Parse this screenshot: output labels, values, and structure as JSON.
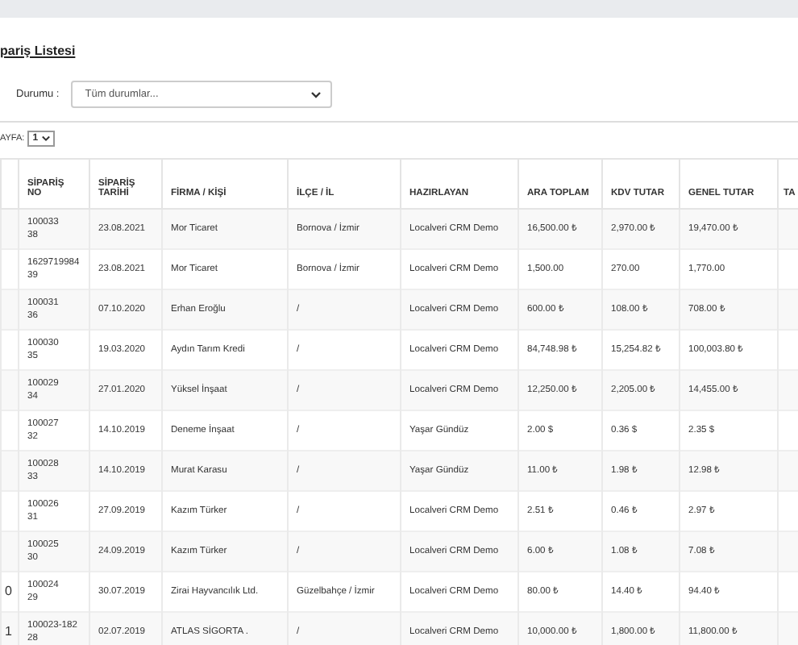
{
  "page": {
    "title": "pariş Listesi"
  },
  "filter": {
    "label": "Durumu :",
    "value": "Tüm durumlar..."
  },
  "pager": {
    "label": "AYFA:",
    "value": "1"
  },
  "table": {
    "columns": [
      "SİPARİŞ NO",
      "SİPARİŞ TARİHİ",
      "FİRMA / KİŞİ",
      "İLÇE / İL",
      "HAZIRLAYAN",
      "ARA TOPLAM",
      "KDV TUTAR",
      "GENEL TUTAR",
      "TA"
    ],
    "rows": [
      {
        "no": "100033 38",
        "date": "23.08.2021",
        "firm": "Mor Ticaret",
        "city": "Bornova / İzmir",
        "by": "Localveri CRM Demo",
        "sub": "16,500.00 ₺",
        "vat": "2,970.00 ₺",
        "total": "19,470.00 ₺"
      },
      {
        "no": "1629719984 39",
        "date": "23.08.2021",
        "firm": "Mor Ticaret",
        "city": "Bornova / İzmir",
        "by": "Localveri CRM Demo",
        "sub": "1,500.00",
        "vat": "270.00",
        "total": "1,770.00"
      },
      {
        "no": "100031 36",
        "date": "07.10.2020",
        "firm": "Erhan Eroğlu",
        "city": "/",
        "by": "Localveri CRM Demo",
        "sub": "600.00 ₺",
        "vat": "108.00 ₺",
        "total": "708.00 ₺"
      },
      {
        "no": "100030 35",
        "date": "19.03.2020",
        "firm": "Aydın Tarım Kredi",
        "city": "/",
        "by": "Localveri CRM Demo",
        "sub": "84,748.98 ₺",
        "vat": "15,254.82 ₺",
        "total": "100,003.80 ₺"
      },
      {
        "no": "100029 34",
        "date": "27.01.2020",
        "firm": "Yüksel İnşaat",
        "city": "/",
        "by": "Localveri CRM Demo",
        "sub": "12,250.00 ₺",
        "vat": "2,205.00 ₺",
        "total": "14,455.00 ₺"
      },
      {
        "no": "100027 32",
        "date": "14.10.2019",
        "firm": "Deneme İnşaat",
        "city": "/",
        "by": "Yaşar Gündüz",
        "sub": "2.00 $",
        "vat": "0.36 $",
        "total": "2.35 $"
      },
      {
        "no": "100028 33",
        "date": "14.10.2019",
        "firm": "Murat Karasu",
        "city": "/",
        "by": "Yaşar Gündüz",
        "sub": "11.00 ₺",
        "vat": "1.98 ₺",
        "total": "12.98 ₺"
      },
      {
        "no": "100026 31",
        "date": "27.09.2019",
        "firm": "Kazım Türker",
        "city": "/",
        "by": "Localveri CRM Demo",
        "sub": "2.51 ₺",
        "vat": "0.46 ₺",
        "total": "2.97 ₺"
      },
      {
        "no": "100025 30",
        "date": "24.09.2019",
        "firm": "Kazım Türker",
        "city": "/",
        "by": "Localveri CRM Demo",
        "sub": "6.00 ₺",
        "vat": "1.08 ₺",
        "total": "7.08 ₺"
      },
      {
        "column_1": "0",
        "no": "100024 29",
        "date": "30.07.2019",
        "firm": "Zirai Hayvancılık Ltd.",
        "city": "Güzelbahçe / İzmir",
        "by": "Localveri CRM Demo",
        "sub": "80.00 ₺",
        "vat": "14.40 ₺",
        "total": "94.40 ₺"
      },
      {
        "column_1": "1",
        "no": "100023-182 28",
        "date": "02.07.2019",
        "firm": "ATLAS SİGORTA .",
        "city": "/",
        "by": "Localveri CRM Demo",
        "sub": "10,000.00 ₺",
        "vat": "1,800.00 ₺",
        "total": "11,800.00 ₺"
      }
    ]
  }
}
